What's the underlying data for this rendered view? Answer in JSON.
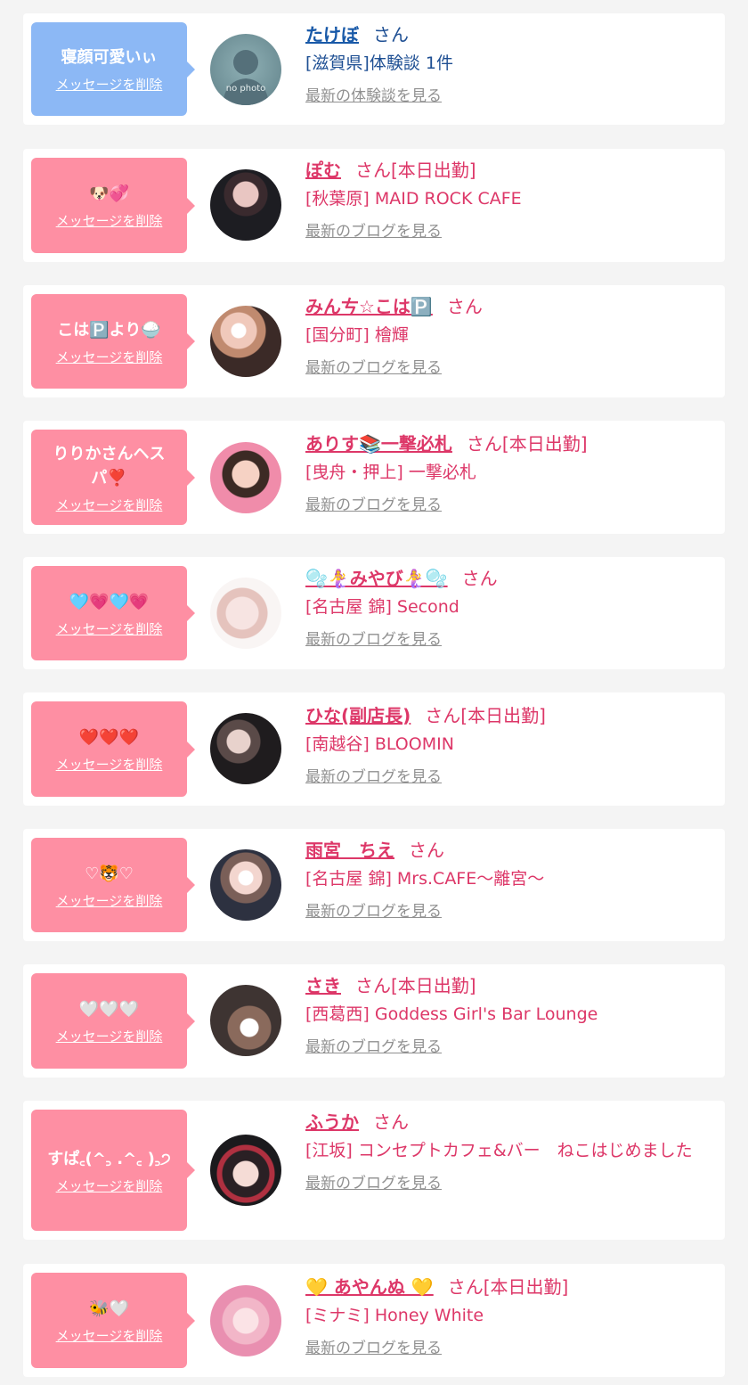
{
  "delete_label": "メッセージを削除",
  "colors": {
    "pink_bubble": "#fe8fa3",
    "blue_bubble": "#8cb8f5",
    "pink_text": "#dd3768",
    "blue_text": "#1e4f93"
  },
  "items": [
    {
      "message": "寝顔可愛いぃ",
      "name": "たけぼ",
      "suffix": "さん",
      "shop": "[滋賀県]体験談 1件",
      "link": "最新の体験談を見る",
      "avatar": "no photo"
    },
    {
      "message": "🐶💞",
      "name": "ぽむ",
      "suffix": "さん[本日出勤]",
      "shop": "[秋葉原] MAID ROCK CAFE",
      "link": "最新のブログを見る"
    },
    {
      "message": "こは🅿️より🍚",
      "name": "みんㄘ☆こは🅿️",
      "suffix": "さん",
      "shop": "[国分町] 檜輝",
      "link": "最新のブログを見る"
    },
    {
      "message": "りりかさんヘスパ❣️",
      "name": "ありす📚一撃必札",
      "suffix": "さん[本日出勤]",
      "shop": "[曳舟・押上] 一撃必札",
      "link": "最新のブログを見る"
    },
    {
      "message": "🩵💗🩵💗",
      "name": "🫧🧜‍♀️みやび🧜‍♀️🫧",
      "suffix": "さん",
      "shop": "[名古屋 錦] Second",
      "link": "最新のブログを見る"
    },
    {
      "message": "❤️❤️❤️",
      "name": "ひな(副店長)",
      "suffix": "さん[本日出勤]",
      "shop": "[南越谷] BLOOMIN",
      "link": "最新のブログを見る"
    },
    {
      "message": "♡🐯♡",
      "name": "雨宮　ちえ",
      "suffix": "さん",
      "shop": "[名古屋 錦] Mrs.CAFE〜離宮〜",
      "link": "最新のブログを見る"
    },
    {
      "message": "🤍🤍🤍",
      "name": "さき",
      "suffix": "さん[本日出勤]",
      "shop": "[西葛西] Goddess Girl's Bar Lounge",
      "link": "最新のブログを見る"
    },
    {
      "message": "すぱ꜀(^꜆ .^꜀ )꜆੭",
      "name": "ふうか",
      "suffix": "さん",
      "shop": "[江坂] コンセプトカフェ&バー　ねこはじめました",
      "link": "最新のブログを見る"
    },
    {
      "message": "🐝🤍",
      "name": "💛 あやんぬ 💛",
      "suffix": "さん[本日出勤]",
      "shop": "[ミナミ] Honey White",
      "link": "最新のブログを見る"
    }
  ]
}
